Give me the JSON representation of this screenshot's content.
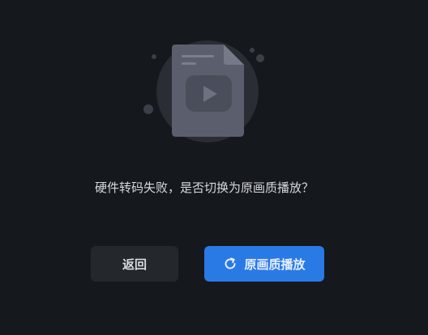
{
  "dialog": {
    "message": "硬件转码失败，是否切换为原画质播放？",
    "back_label": "返回",
    "play_label": "原画质播放",
    "illustration_icon": "video-file-icon",
    "refresh_icon": "refresh-icon"
  },
  "colors": {
    "background": "#15181c",
    "primary": "#2a7ae6",
    "secondary_button": "#24272c",
    "text": "#d6d9de"
  }
}
